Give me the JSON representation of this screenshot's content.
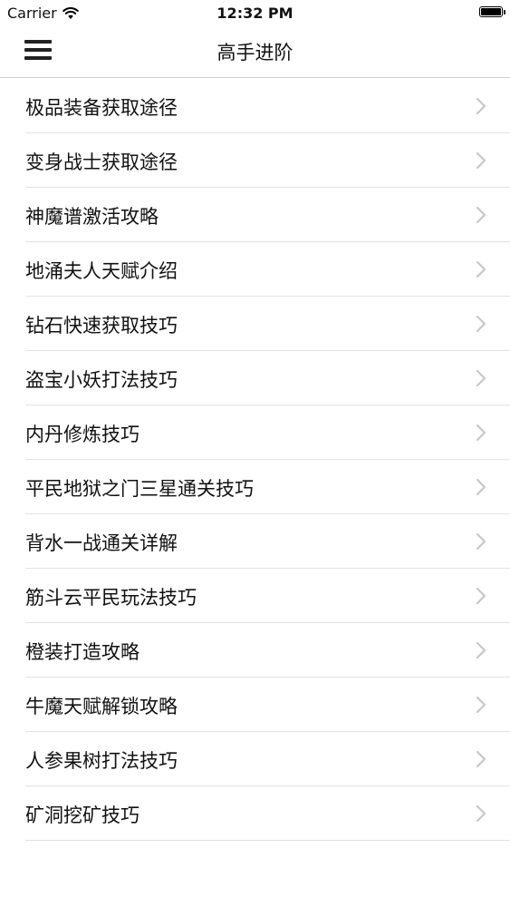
{
  "status_bar": {
    "carrier": "Carrier",
    "time": "12:32 PM"
  },
  "nav": {
    "title": "高手进阶",
    "menu_icon": "hamburger-menu-icon"
  },
  "list": {
    "items": [
      {
        "label": "极品装备获取途径"
      },
      {
        "label": "变身战士获取途径"
      },
      {
        "label": "神魔谱激活攻略"
      },
      {
        "label": "地涌夫人天赋介绍"
      },
      {
        "label": "钻石快速获取技巧"
      },
      {
        "label": "盗宝小妖打法技巧"
      },
      {
        "label": "内丹修炼技巧"
      },
      {
        "label": "平民地狱之门三星通关技巧"
      },
      {
        "label": "背水一战通关详解"
      },
      {
        "label": "筋斗云平民玩法技巧"
      },
      {
        "label": "橙装打造攻略"
      },
      {
        "label": "牛魔天赋解锁攻略"
      },
      {
        "label": "人参果树打法技巧"
      },
      {
        "label": "矿洞挖矿技巧"
      }
    ],
    "chevron_color": "#c7c7cc"
  }
}
